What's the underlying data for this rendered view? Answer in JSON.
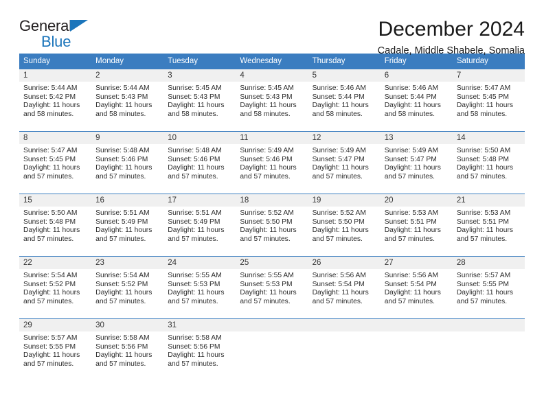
{
  "brand": {
    "name_part1": "General",
    "name_part2": "Blue",
    "accent_color": "#1b75bb"
  },
  "header": {
    "title": "December 2024",
    "subtitle": "Cadale, Middle Shabele, Somalia"
  },
  "calendar": {
    "header_color": "#3b7dc0",
    "weekdays": [
      "Sunday",
      "Monday",
      "Tuesday",
      "Wednesday",
      "Thursday",
      "Friday",
      "Saturday"
    ],
    "weeks": [
      [
        {
          "day": "1",
          "sunrise": "Sunrise: 5:44 AM",
          "sunset": "Sunset: 5:42 PM",
          "daylight1": "Daylight: 11 hours",
          "daylight2": "and 58 minutes."
        },
        {
          "day": "2",
          "sunrise": "Sunrise: 5:44 AM",
          "sunset": "Sunset: 5:43 PM",
          "daylight1": "Daylight: 11 hours",
          "daylight2": "and 58 minutes."
        },
        {
          "day": "3",
          "sunrise": "Sunrise: 5:45 AM",
          "sunset": "Sunset: 5:43 PM",
          "daylight1": "Daylight: 11 hours",
          "daylight2": "and 58 minutes."
        },
        {
          "day": "4",
          "sunrise": "Sunrise: 5:45 AM",
          "sunset": "Sunset: 5:43 PM",
          "daylight1": "Daylight: 11 hours",
          "daylight2": "and 58 minutes."
        },
        {
          "day": "5",
          "sunrise": "Sunrise: 5:46 AM",
          "sunset": "Sunset: 5:44 PM",
          "daylight1": "Daylight: 11 hours",
          "daylight2": "and 58 minutes."
        },
        {
          "day": "6",
          "sunrise": "Sunrise: 5:46 AM",
          "sunset": "Sunset: 5:44 PM",
          "daylight1": "Daylight: 11 hours",
          "daylight2": "and 58 minutes."
        },
        {
          "day": "7",
          "sunrise": "Sunrise: 5:47 AM",
          "sunset": "Sunset: 5:45 PM",
          "daylight1": "Daylight: 11 hours",
          "daylight2": "and 58 minutes."
        }
      ],
      [
        {
          "day": "8",
          "sunrise": "Sunrise: 5:47 AM",
          "sunset": "Sunset: 5:45 PM",
          "daylight1": "Daylight: 11 hours",
          "daylight2": "and 57 minutes."
        },
        {
          "day": "9",
          "sunrise": "Sunrise: 5:48 AM",
          "sunset": "Sunset: 5:46 PM",
          "daylight1": "Daylight: 11 hours",
          "daylight2": "and 57 minutes."
        },
        {
          "day": "10",
          "sunrise": "Sunrise: 5:48 AM",
          "sunset": "Sunset: 5:46 PM",
          "daylight1": "Daylight: 11 hours",
          "daylight2": "and 57 minutes."
        },
        {
          "day": "11",
          "sunrise": "Sunrise: 5:49 AM",
          "sunset": "Sunset: 5:46 PM",
          "daylight1": "Daylight: 11 hours",
          "daylight2": "and 57 minutes."
        },
        {
          "day": "12",
          "sunrise": "Sunrise: 5:49 AM",
          "sunset": "Sunset: 5:47 PM",
          "daylight1": "Daylight: 11 hours",
          "daylight2": "and 57 minutes."
        },
        {
          "day": "13",
          "sunrise": "Sunrise: 5:49 AM",
          "sunset": "Sunset: 5:47 PM",
          "daylight1": "Daylight: 11 hours",
          "daylight2": "and 57 minutes."
        },
        {
          "day": "14",
          "sunrise": "Sunrise: 5:50 AM",
          "sunset": "Sunset: 5:48 PM",
          "daylight1": "Daylight: 11 hours",
          "daylight2": "and 57 minutes."
        }
      ],
      [
        {
          "day": "15",
          "sunrise": "Sunrise: 5:50 AM",
          "sunset": "Sunset: 5:48 PM",
          "daylight1": "Daylight: 11 hours",
          "daylight2": "and 57 minutes."
        },
        {
          "day": "16",
          "sunrise": "Sunrise: 5:51 AM",
          "sunset": "Sunset: 5:49 PM",
          "daylight1": "Daylight: 11 hours",
          "daylight2": "and 57 minutes."
        },
        {
          "day": "17",
          "sunrise": "Sunrise: 5:51 AM",
          "sunset": "Sunset: 5:49 PM",
          "daylight1": "Daylight: 11 hours",
          "daylight2": "and 57 minutes."
        },
        {
          "day": "18",
          "sunrise": "Sunrise: 5:52 AM",
          "sunset": "Sunset: 5:50 PM",
          "daylight1": "Daylight: 11 hours",
          "daylight2": "and 57 minutes."
        },
        {
          "day": "19",
          "sunrise": "Sunrise: 5:52 AM",
          "sunset": "Sunset: 5:50 PM",
          "daylight1": "Daylight: 11 hours",
          "daylight2": "and 57 minutes."
        },
        {
          "day": "20",
          "sunrise": "Sunrise: 5:53 AM",
          "sunset": "Sunset: 5:51 PM",
          "daylight1": "Daylight: 11 hours",
          "daylight2": "and 57 minutes."
        },
        {
          "day": "21",
          "sunrise": "Sunrise: 5:53 AM",
          "sunset": "Sunset: 5:51 PM",
          "daylight1": "Daylight: 11 hours",
          "daylight2": "and 57 minutes."
        }
      ],
      [
        {
          "day": "22",
          "sunrise": "Sunrise: 5:54 AM",
          "sunset": "Sunset: 5:52 PM",
          "daylight1": "Daylight: 11 hours",
          "daylight2": "and 57 minutes."
        },
        {
          "day": "23",
          "sunrise": "Sunrise: 5:54 AM",
          "sunset": "Sunset: 5:52 PM",
          "daylight1": "Daylight: 11 hours",
          "daylight2": "and 57 minutes."
        },
        {
          "day": "24",
          "sunrise": "Sunrise: 5:55 AM",
          "sunset": "Sunset: 5:53 PM",
          "daylight1": "Daylight: 11 hours",
          "daylight2": "and 57 minutes."
        },
        {
          "day": "25",
          "sunrise": "Sunrise: 5:55 AM",
          "sunset": "Sunset: 5:53 PM",
          "daylight1": "Daylight: 11 hours",
          "daylight2": "and 57 minutes."
        },
        {
          "day": "26",
          "sunrise": "Sunrise: 5:56 AM",
          "sunset": "Sunset: 5:54 PM",
          "daylight1": "Daylight: 11 hours",
          "daylight2": "and 57 minutes."
        },
        {
          "day": "27",
          "sunrise": "Sunrise: 5:56 AM",
          "sunset": "Sunset: 5:54 PM",
          "daylight1": "Daylight: 11 hours",
          "daylight2": "and 57 minutes."
        },
        {
          "day": "28",
          "sunrise": "Sunrise: 5:57 AM",
          "sunset": "Sunset: 5:55 PM",
          "daylight1": "Daylight: 11 hours",
          "daylight2": "and 57 minutes."
        }
      ],
      [
        {
          "day": "29",
          "sunrise": "Sunrise: 5:57 AM",
          "sunset": "Sunset: 5:55 PM",
          "daylight1": "Daylight: 11 hours",
          "daylight2": "and 57 minutes."
        },
        {
          "day": "30",
          "sunrise": "Sunrise: 5:58 AM",
          "sunset": "Sunset: 5:56 PM",
          "daylight1": "Daylight: 11 hours",
          "daylight2": "and 57 minutes."
        },
        {
          "day": "31",
          "sunrise": "Sunrise: 5:58 AM",
          "sunset": "Sunset: 5:56 PM",
          "daylight1": "Daylight: 11 hours",
          "daylight2": "and 57 minutes."
        },
        {
          "day": "",
          "sunrise": "",
          "sunset": "",
          "daylight1": "",
          "daylight2": ""
        },
        {
          "day": "",
          "sunrise": "",
          "sunset": "",
          "daylight1": "",
          "daylight2": ""
        },
        {
          "day": "",
          "sunrise": "",
          "sunset": "",
          "daylight1": "",
          "daylight2": ""
        },
        {
          "day": "",
          "sunrise": "",
          "sunset": "",
          "daylight1": "",
          "daylight2": ""
        }
      ]
    ]
  }
}
